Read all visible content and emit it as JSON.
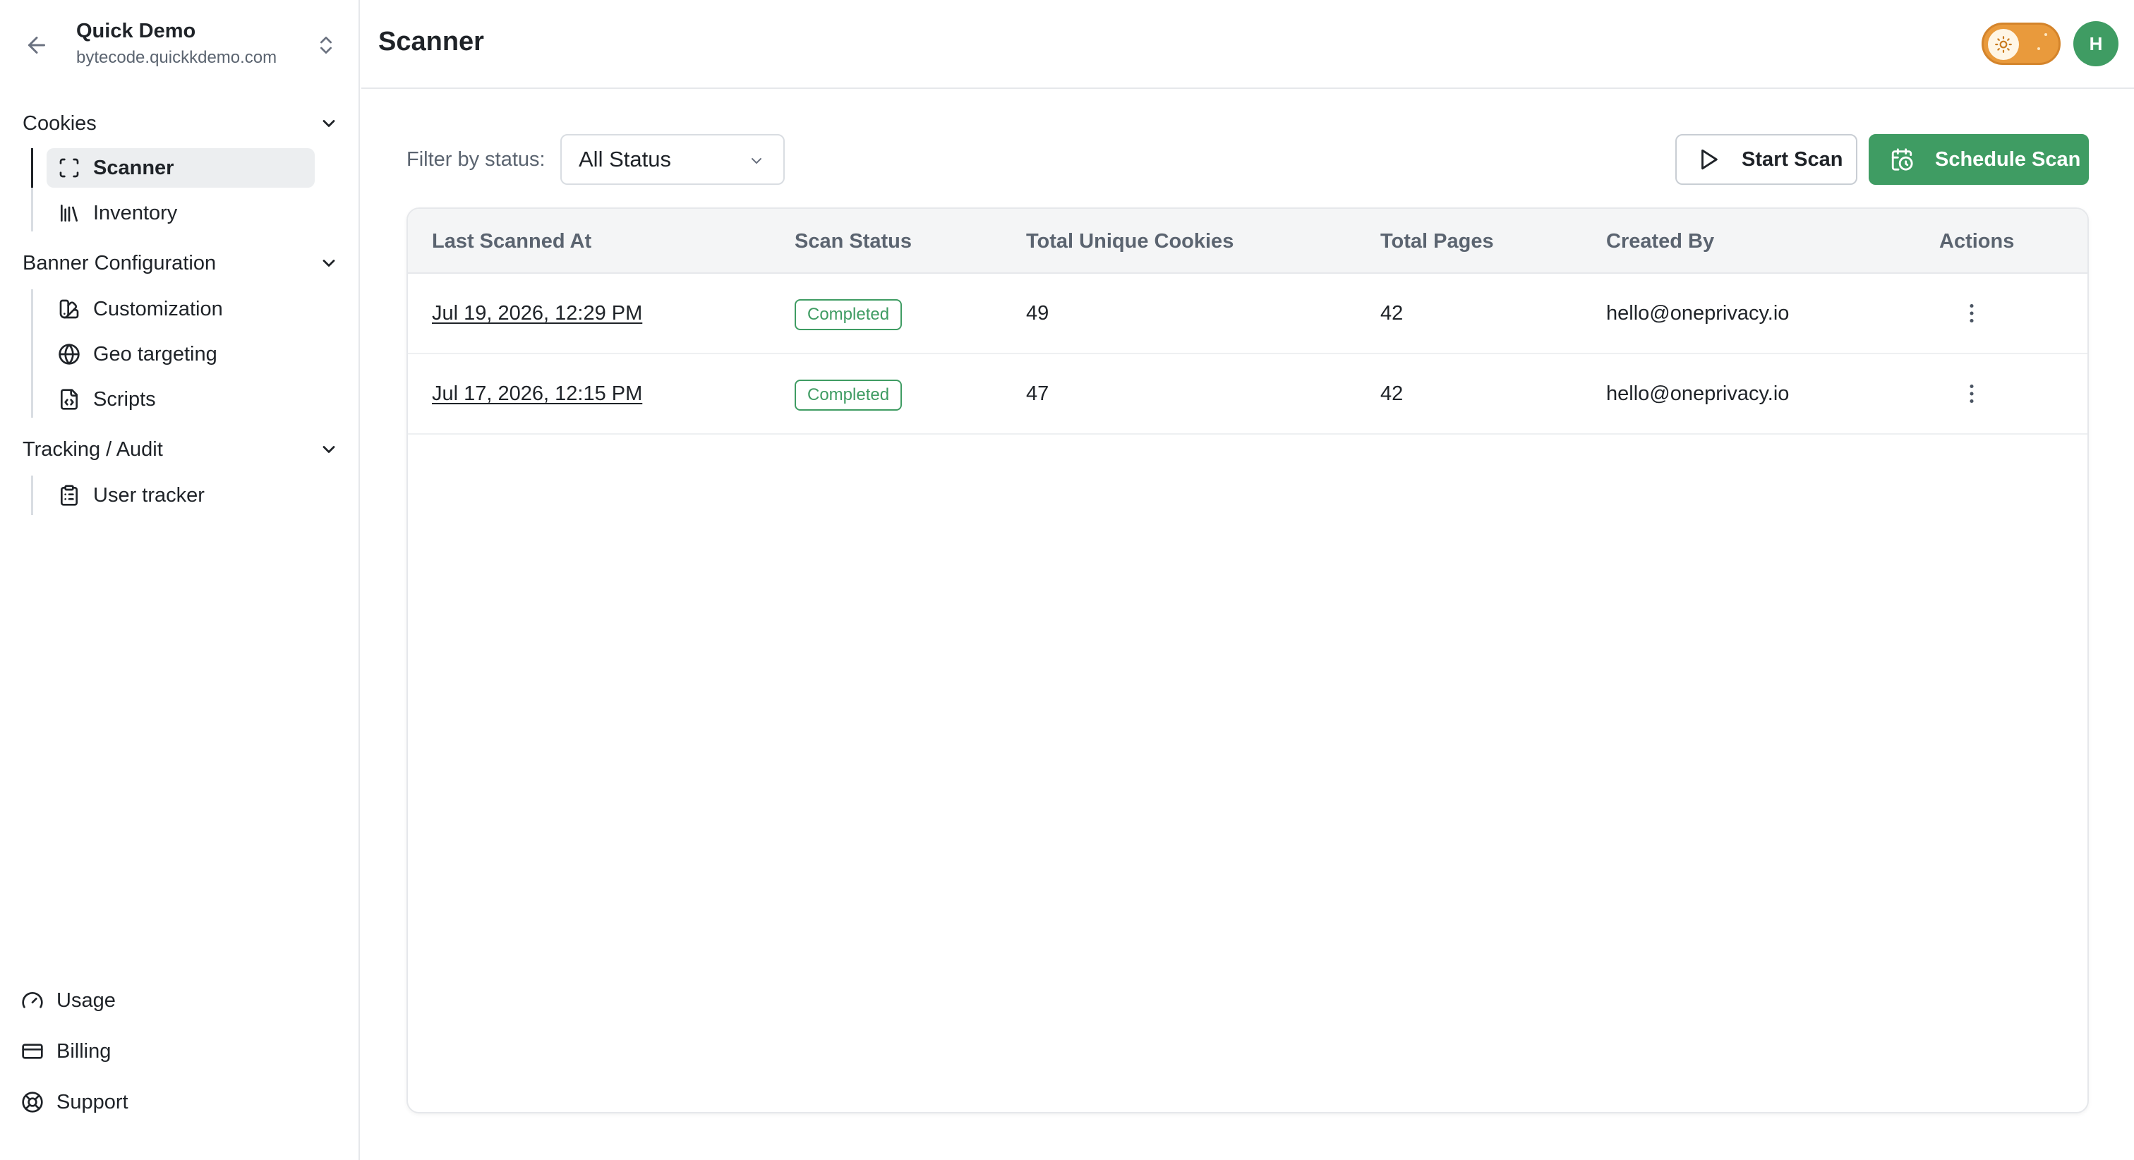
{
  "workspace": {
    "name": "Quick Demo",
    "domain": "bytecode.quickkdemo.com"
  },
  "sidebar": {
    "sections": [
      {
        "label": "Cookies",
        "items": [
          {
            "label": "Scanner",
            "icon": "scan-frame-icon",
            "active": true
          },
          {
            "label": "Inventory",
            "icon": "library-icon",
            "active": false
          }
        ]
      },
      {
        "label": "Banner Configuration",
        "items": [
          {
            "label": "Customization",
            "icon": "swatch-book-icon",
            "active": false
          },
          {
            "label": "Geo targeting",
            "icon": "globe-icon",
            "active": false
          },
          {
            "label": "Scripts",
            "icon": "file-code-icon",
            "active": false
          }
        ]
      },
      {
        "label": "Tracking / Audit",
        "items": [
          {
            "label": "User tracker",
            "icon": "clipboard-list-icon",
            "active": false
          }
        ]
      }
    ],
    "bottom": [
      {
        "label": "Usage",
        "icon": "gauge-icon"
      },
      {
        "label": "Billing",
        "icon": "credit-card-icon"
      },
      {
        "label": "Support",
        "icon": "life-buoy-icon"
      }
    ]
  },
  "header": {
    "title": "Scanner",
    "avatar_initial": "H",
    "theme": "light"
  },
  "toolbar": {
    "filter_label": "Filter by status:",
    "filter_value": "All Status",
    "start_scan_label": "Start Scan",
    "schedule_scan_label": "Schedule Scan"
  },
  "table": {
    "columns": [
      "Last Scanned At",
      "Scan Status",
      "Total Unique Cookies",
      "Total Pages",
      "Created By",
      "Actions"
    ],
    "rows": [
      {
        "scanned_at": "Jul 19, 2026, 12:29 PM",
        "status": "Completed",
        "cookies": "49",
        "pages": "42",
        "created_by": "hello@oneprivacy.io"
      },
      {
        "scanned_at": "Jul 17, 2026, 12:15 PM",
        "status": "Completed",
        "cookies": "47",
        "pages": "42",
        "created_by": "hello@oneprivacy.io"
      }
    ]
  },
  "colors": {
    "accent_green": "#3f9c63",
    "toggle_orange": "#e99a3c",
    "border": "#e6e8eb",
    "active_nav_bg": "#eceef0"
  }
}
